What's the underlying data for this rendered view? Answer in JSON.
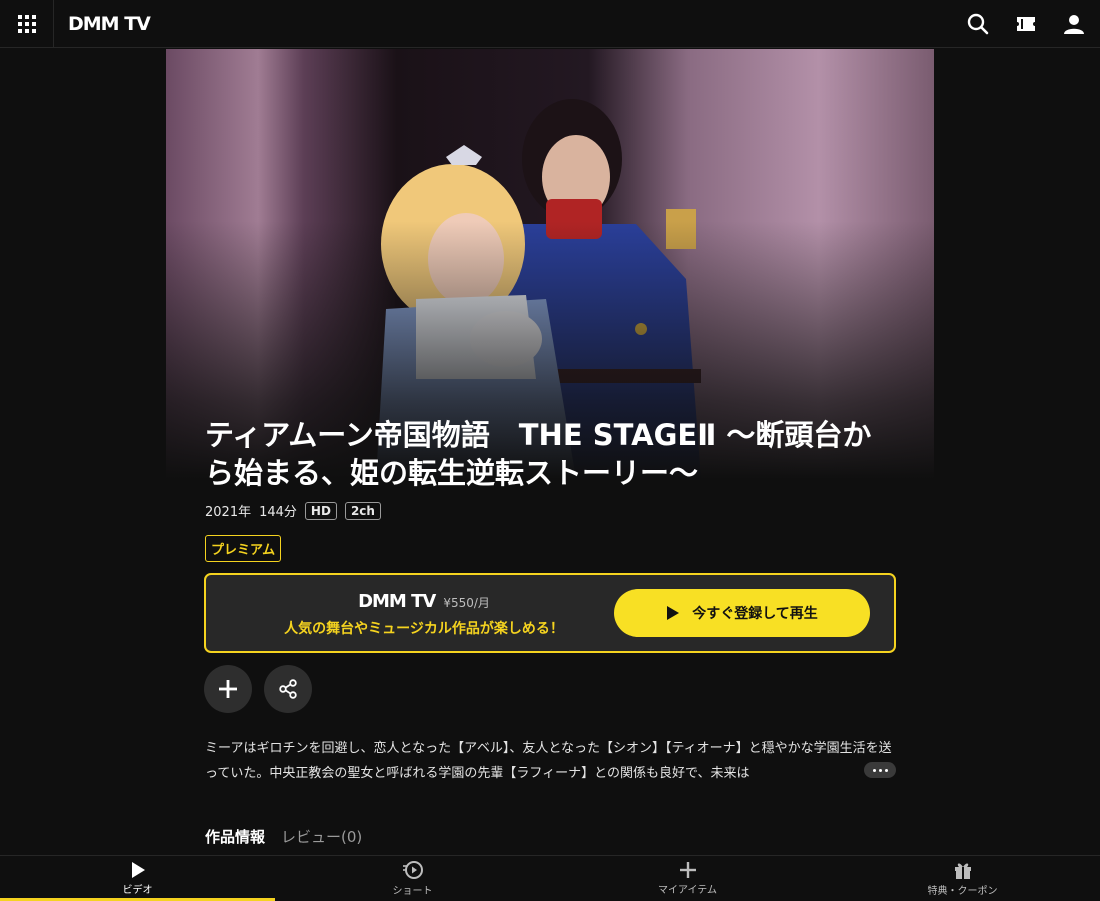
{
  "header": {
    "logo": "DMM TV",
    "icons": [
      "grid-menu-icon",
      "search-icon",
      "ticket-icon",
      "user-icon"
    ]
  },
  "title": "ティアムーン帝国物語　THE STAGEⅡ ～断頭台から始まる、姫の転生逆転ストーリー～",
  "meta": {
    "year": "2021年",
    "duration": "144分",
    "quality": "HD",
    "audio": "2ch"
  },
  "premium_badge": "プレミアム",
  "cta": {
    "logo": "DMM TV",
    "price": "¥550/月",
    "message": "人気の舞台やミュージカル作品が楽しめる！",
    "play_button": "今すぐ登録して再生"
  },
  "description": "ミーアはギロチンを回避し、恋人となった【アベル】、友人となった【シオン】【ティオーナ】と穏やかな学園生活を送っていた。中央正教会の聖女と呼ばれる学園の先輩【ラフィーナ】との関係も良好で、未来は",
  "tabs": {
    "info": "作品情報",
    "review": "レビュー(0)"
  },
  "bottom_nav": {
    "video": "ビデオ",
    "short": "ショート",
    "my_items": "マイアイテム",
    "benefits": "特典・クーポン"
  },
  "colors": {
    "accent": "#f5d31f",
    "background": "#0f0f0f"
  }
}
